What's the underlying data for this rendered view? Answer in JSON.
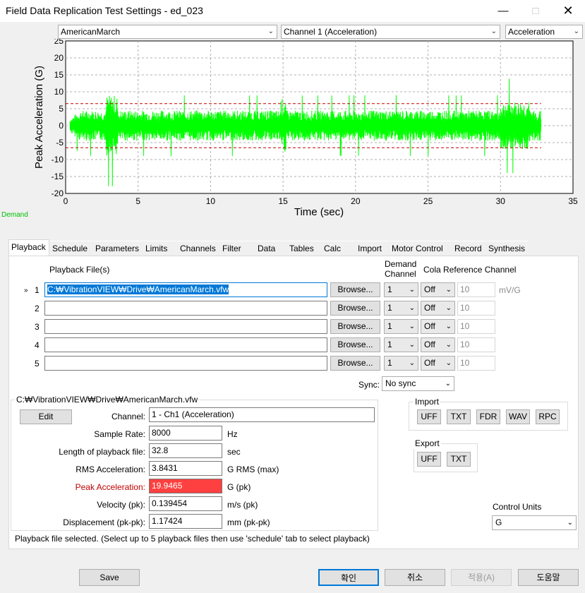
{
  "window": {
    "title": "Field Data Replication Test Settings - ed_023"
  },
  "toolbar": {
    "profile": "AmericanMarch",
    "channel": "Channel 1 (Acceleration)",
    "units": "Acceleration"
  },
  "chart_data": {
    "type": "line",
    "ylabel": "Peak Acceleration (G)",
    "xlabel": "Time (sec)",
    "xlim": [
      0,
      35
    ],
    "ylim": [
      -20,
      25
    ],
    "x_ticks": [
      "0",
      "5",
      "10",
      "15",
      "20",
      "25",
      "30",
      "35"
    ],
    "y_ticks": [
      "25",
      "20",
      "15",
      "10",
      "5",
      "0",
      "-5",
      "-10",
      "-15",
      "-20"
    ],
    "grid": "dashed",
    "series": [
      {
        "color": "#00ff00",
        "x_start": 0.3,
        "x_end": 32.8,
        "rms": 3.8431,
        "peak": 19.9465
      }
    ],
    "limit_lines": [
      {
        "value": 6.5,
        "color": "#c00000"
      },
      {
        "value": -6.5,
        "color": "#c00000"
      }
    ],
    "demand_label": "Demand"
  },
  "tabs": [
    "Playback",
    "Schedule",
    "Parameters",
    "Limits",
    "Channels",
    "Filter",
    "Data",
    "Tables",
    "Calc",
    "Import",
    "Motor Control",
    "Record",
    "Synthesis"
  ],
  "playback": {
    "files_header": "Playback File(s)",
    "demand_header_1": "Demand",
    "demand_header_2": "Channel",
    "cola_header": "Cola Reference Channel",
    "browse": "Browse...",
    "unit": "mV/G",
    "marker": "»",
    "rows": [
      {
        "num": "1",
        "file": "C:₩VibrationVIEW₩Drive₩AmericanMarch.vfw",
        "demand": "1",
        "cola": "Off",
        "ref": "10"
      },
      {
        "num": "2",
        "file": "",
        "demand": "1",
        "cola": "Off",
        "ref": "10"
      },
      {
        "num": "3",
        "file": "",
        "demand": "1",
        "cola": "Off",
        "ref": "10"
      },
      {
        "num": "4",
        "file": "",
        "demand": "1",
        "cola": "Off",
        "ref": "10"
      },
      {
        "num": "5",
        "file": "",
        "demand": "1",
        "cola": "Off",
        "ref": "10"
      }
    ],
    "sync_label": "Sync:",
    "sync_value": "No sync"
  },
  "fileinfo": {
    "title": "C:₩VibrationVIEW₩Drive₩AmericanMarch.vfw",
    "edit": "Edit",
    "channel_label": "Channel:",
    "channel_value": "1 - Ch1 (Acceleration)",
    "rate_label": "Sample Rate:",
    "rate_value": "8000",
    "rate_unit": "Hz",
    "length_label": "Length of playback file:",
    "length_value": "32.8",
    "length_unit": "sec",
    "rms_label": "RMS Acceleration:",
    "rms_value": "3.8431",
    "rms_unit": "G RMS (max)",
    "peak_label": "Peak Acceleration:",
    "peak_value": "19.9465",
    "peak_unit": "G (pk)",
    "vel_label": "Velocity (pk):",
    "vel_value": "0.139454",
    "vel_unit": "m/s (pk)",
    "disp_label": "Displacement (pk-pk):",
    "disp_value": "1.17424",
    "disp_unit": "mm (pk-pk)"
  },
  "import": {
    "title": "Import",
    "buttons": [
      "UFF",
      "TXT",
      "FDR",
      "WAV",
      "RPC"
    ]
  },
  "export": {
    "title": "Export",
    "buttons": [
      "UFF",
      "TXT"
    ]
  },
  "control_units": {
    "label": "Control Units",
    "value": "G"
  },
  "status": "Playback file selected. (Select up to 5 playback files then use 'schedule' tab to select playback)",
  "footer": {
    "save": "Save",
    "ok": "확인",
    "cancel": "취소",
    "apply": "적용(A)",
    "help": "도움말"
  }
}
